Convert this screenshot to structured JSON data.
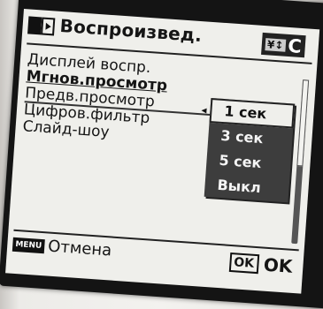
{
  "header": {
    "title": "Воспроизвед.",
    "mode_icon": "playback-mode-icon",
    "tab_glyph": "¥↕",
    "tab_letter": "C"
  },
  "menu": {
    "items": [
      {
        "label": "Дисплей воспр."
      },
      {
        "label": "Мгнов.просмотр"
      },
      {
        "label": "Предв.просмотр"
      },
      {
        "label": "Цифров.фильтр"
      },
      {
        "label": "Слайд-шоу"
      }
    ],
    "active_index": 1
  },
  "options": {
    "items": [
      "1 сек",
      "3 сек",
      "5 сек",
      "Выкл"
    ],
    "selected_index": 0,
    "selected_marker": "◂"
  },
  "footer": {
    "menu_badge": "MENU",
    "cancel_label": "Отмена",
    "ok_badge": "OK",
    "ok_label": "OK"
  }
}
